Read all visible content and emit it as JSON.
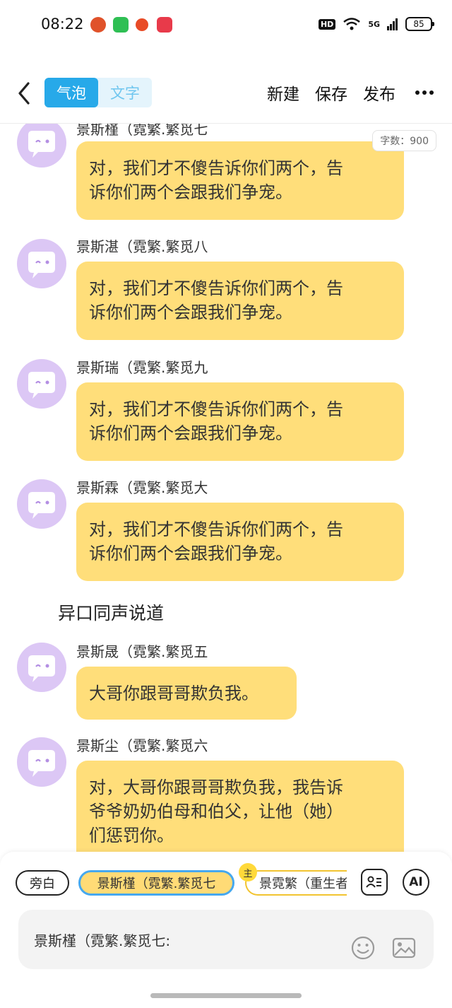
{
  "status_bar": {
    "time": "08:22",
    "network": "5G",
    "battery": "85"
  },
  "toolbar": {
    "tabs": [
      {
        "label": "气泡",
        "active": true
      },
      {
        "label": "文字",
        "active": false
      }
    ],
    "new_label": "新建",
    "save_label": "保存",
    "publish_label": "发布"
  },
  "word_count": "字数：900",
  "messages": [
    {
      "name": "景斯槿（霓繁.繁觅七",
      "lines": [
        "对，我们才不傻告诉你们两个，告",
        "诉你们两个会跟我们争宠。"
      ]
    },
    {
      "name": "景斯湛（霓繁.繁觅八",
      "lines": [
        "对，我们才不傻告诉你们两个，告",
        "诉你们两个会跟我们争宠。"
      ]
    },
    {
      "name": "景斯瑞（霓繁.繁觅九",
      "lines": [
        "对，我们才不傻告诉你们两个，告",
        "诉你们两个会跟我们争宠。"
      ]
    },
    {
      "name": "景斯霖（霓繁.繁觅大",
      "lines": [
        "对，我们才不傻告诉你们两个，告",
        "诉你们两个会跟我们争宠。"
      ]
    },
    {
      "name": "景斯晟（霓繁.繁觅五",
      "lines": [
        "大哥你跟哥哥欺负我。"
      ]
    },
    {
      "name": "景斯尘（霓繁.繁觅六",
      "lines": [
        "对，大哥你跟哥哥欺负我，我告诉",
        "爷爷奶奶伯母和伯父，让他（她）",
        "们惩罚你。"
      ]
    }
  ],
  "narration": "异口同声说道",
  "role_bar": {
    "narrator": "旁白",
    "selected": "景斯槿（霓繁.繁觅七",
    "lead_badge": "主",
    "third": "景霓繁（重生者",
    "ai": "AI"
  },
  "input_text": "景斯槿（霓繁.繁觅七:",
  "colors": {
    "accent": "#27a9e9",
    "bubble": "#ffde7a",
    "avatar": "#dcc7f5"
  }
}
